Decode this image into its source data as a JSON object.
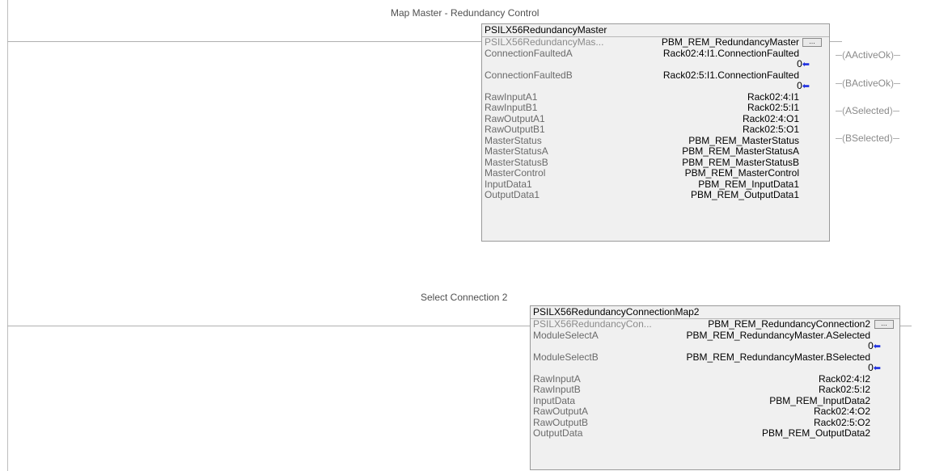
{
  "rung1": {
    "comment": "Map Master - Redundancy Control",
    "block": {
      "title": "PSILX56RedundancyMaster",
      "instance": {
        "name": "PSILX56RedundancyMas...",
        "value": "PBM_REM_RedundancyMaster",
        "button": "..."
      },
      "params": [
        {
          "name": "ConnectionFaultedA",
          "value": "Rack02:4:I1.ConnectionFaulted",
          "zero": "0"
        },
        {
          "name": "ConnectionFaultedB",
          "value": "Rack02:5:I1.ConnectionFaulted",
          "zero": "0"
        },
        {
          "name": "RawInputA1",
          "value": "Rack02:4:I1"
        },
        {
          "name": "RawInputB1",
          "value": "Rack02:5:I1"
        },
        {
          "name": "RawOutputA1",
          "value": "Rack02:4:O1"
        },
        {
          "name": "RawOutputB1",
          "value": "Rack02:5:O1"
        },
        {
          "name": "MasterStatus",
          "value": "PBM_REM_MasterStatus"
        },
        {
          "name": "MasterStatusA",
          "value": "PBM_REM_MasterStatusA"
        },
        {
          "name": "MasterStatusB",
          "value": "PBM_REM_MasterStatusB"
        },
        {
          "name": "MasterControl",
          "value": "PBM_REM_MasterControl"
        },
        {
          "name": "InputData1",
          "value": "PBM_REM_InputData1"
        },
        {
          "name": "OutputData1",
          "value": "PBM_REM_OutputData1"
        }
      ]
    },
    "coils": [
      "AActiveOk",
      "BActiveOk",
      "ASelected",
      "BSelected"
    ]
  },
  "rung2": {
    "comment": "Select Connection 2",
    "block": {
      "title": "PSILX56RedundancyConnectionMap2",
      "instance": {
        "name": "PSILX56RedundancyCon...",
        "value": "PBM_REM_RedundancyConnection2",
        "button": "..."
      },
      "params": [
        {
          "name": "ModuleSelectA",
          "value": "PBM_REM_RedundancyMaster.ASelected",
          "zero": "0"
        },
        {
          "name": "ModuleSelectB",
          "value": "PBM_REM_RedundancyMaster.BSelected",
          "zero": "0"
        },
        {
          "name": "RawInputA",
          "value": "Rack02:4:I2"
        },
        {
          "name": "RawInputB",
          "value": "Rack02:5:I2"
        },
        {
          "name": "InputData",
          "value": "PBM_REM_InputData2"
        },
        {
          "name": "RawOutputA",
          "value": "Rack02:4:O2"
        },
        {
          "name": "RawOutputB",
          "value": "Rack02:5:O2"
        },
        {
          "name": "OutputData",
          "value": "PBM_REM_OutputData2"
        }
      ]
    }
  }
}
